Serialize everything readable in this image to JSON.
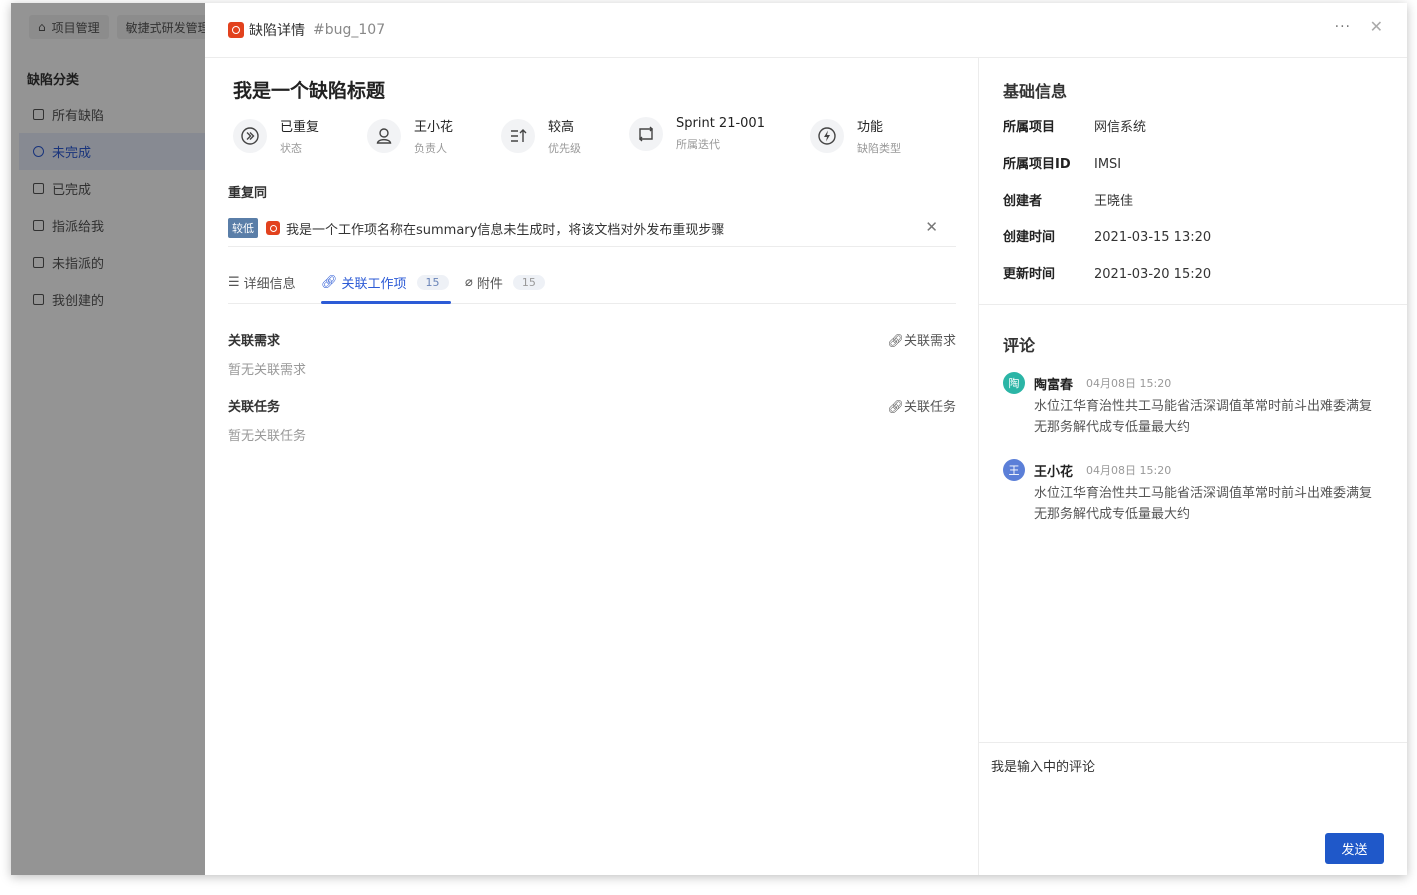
{
  "bg": {
    "tabs": [
      "项目管理",
      "敏捷式研发管理"
    ],
    "side_title": "缺陷分类",
    "items": [
      {
        "label": "所有缺陷"
      },
      {
        "label": "未完成"
      },
      {
        "label": "已完成"
      },
      {
        "label": "指派给我"
      },
      {
        "label": "未指派的"
      },
      {
        "label": "我创建的"
      }
    ]
  },
  "header": {
    "title": "缺陷详情",
    "code": "#bug_107",
    "more": "···",
    "close": "✕"
  },
  "bug": {
    "title": "我是一个缺陷标题",
    "props": [
      {
        "value": "已重复",
        "label": "状态",
        "icon": "skip-forward-icon"
      },
      {
        "value": "王小花",
        "label": "负责人",
        "icon": "user-icon"
      },
      {
        "value": "较高",
        "label": "优先级",
        "icon": "priority-icon"
      },
      {
        "value": "Sprint 21-001",
        "label": "所属迭代",
        "icon": "iteration-icon"
      },
      {
        "value": "功能",
        "label": "缺陷类型",
        "icon": "lightning-icon"
      }
    ],
    "dup_label": "重复同",
    "dup_tag": "较低",
    "dup_text": "我是一个工作项名称在summary信息未生成时，将该文档对外发布重现步骤",
    "dup_close": "✕"
  },
  "tabs": [
    {
      "label": "详细信息"
    },
    {
      "label": "关联工作项",
      "count": "15"
    },
    {
      "label": "附件",
      "count": "15"
    }
  ],
  "sections": [
    {
      "title": "关联需求",
      "link": "关联需求",
      "empty": "暂无关联需求"
    },
    {
      "title": "关联任务",
      "link": "关联任务",
      "empty": "暂无关联任务"
    }
  ],
  "basic": {
    "title": "基础信息",
    "rows": [
      {
        "k": "所属项目",
        "v": "网信系统"
      },
      {
        "k": "所属项目ID",
        "v": "IMSI"
      },
      {
        "k": "创建者",
        "v": "王晓佳"
      },
      {
        "k": "创建时间",
        "v": "2021-03-15 13:20"
      },
      {
        "k": "更新时间",
        "v": "2021-03-20 15:20"
      }
    ]
  },
  "comments": {
    "title": "评论",
    "items": [
      {
        "avatar": "陶",
        "avatar_color": "#2bb5a6",
        "name": "陶富春",
        "time": "04月08日 15:20",
        "body": "水位江华育治性共工马能省活深调值革常时前斗出难委满复无那务解代成专低量最大约"
      },
      {
        "avatar": "王",
        "avatar_color": "#5b7fd8",
        "name": "王小花",
        "time": "04月08日 15:20",
        "body": "水位江华育治性共工马能省活深调值革常时前斗出难委满复无那务解代成专低量最大约"
      }
    ],
    "input": "我是输入中的评论",
    "send": "发送"
  },
  "colors": {
    "accent": "#2c5bd6",
    "bug_red": "#e2421e",
    "send_blue": "#1f58c9"
  }
}
